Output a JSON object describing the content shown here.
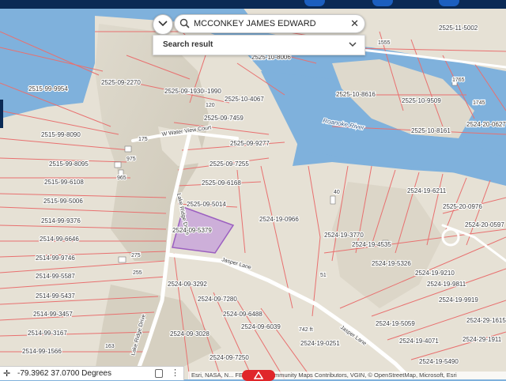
{
  "search": {
    "value": "MCCONKEY JAMES EDWARD",
    "result_label": "Search result"
  },
  "coordinates": {
    "text": "-79.3962 37.0700 Degrees"
  },
  "attribution": {
    "text": "Esri, NASA, N...   FEMA, Esri Community Maps Contributors, VGIN, © OpenStreetMap, Microsoft, Esri"
  },
  "colors": {
    "water": "#7fb1dc",
    "land": "#e8e4da",
    "hillshade": "#c9c3b2",
    "parcel_line": "#e8706f",
    "parcel_label": "#3a3a3a",
    "selected_fill": "#c7a2d9",
    "selected_stroke": "#9b5fc0",
    "road": "#ffffff",
    "accent": "#0b2a55"
  },
  "map": {
    "river_label": "Roanoke River",
    "roads": [
      {
        "id": "water-view-court",
        "label": "W Water View Court"
      },
      {
        "id": "lake-ridge-drive-upper",
        "label": "Lake Ridge Drive"
      },
      {
        "id": "lake-ridge-drive-lower",
        "label": "Lake Ridge Drive"
      },
      {
        "id": "jasper-lane-upper",
        "label": "Jasper Lane"
      },
      {
        "id": "jasper-lane-lower",
        "label": "Jasper Lane"
      }
    ],
    "parcels": [
      {
        "id": "p1",
        "label": "2525-09-1990"
      },
      {
        "id": "p2",
        "label": "2525-09-2270"
      },
      {
        "id": "p3",
        "label": "2525-09-1930"
      },
      {
        "id": "p4",
        "label": "2525-09-7459"
      },
      {
        "id": "p5",
        "label": "2525-10-4067"
      },
      {
        "id": "p6",
        "label": "2525-09-9277"
      },
      {
        "id": "p7",
        "label": "2525-09-7255"
      },
      {
        "id": "p8",
        "label": "2525-09-6168"
      },
      {
        "id": "p9",
        "label": "2525-09-5014"
      },
      {
        "id": "p10",
        "label": "2524-09-5379"
      },
      {
        "id": "p11",
        "label": "2524-19-0966"
      },
      {
        "id": "p12",
        "label": "2515-99-9954"
      },
      {
        "id": "p13",
        "label": "2515-99-8090"
      },
      {
        "id": "p14",
        "label": "2515-99-8095"
      },
      {
        "id": "p15",
        "label": "2515-99-6108"
      },
      {
        "id": "p16",
        "label": "2515-99-5006"
      },
      {
        "id": "p17",
        "label": "2514-99-9376"
      },
      {
        "id": "p18",
        "label": "2514-99-6646"
      },
      {
        "id": "p19",
        "label": "2514-99-9746"
      },
      {
        "id": "p20",
        "label": "2514-99-5587"
      },
      {
        "id": "p21",
        "label": "2514-99-5437"
      },
      {
        "id": "p22",
        "label": "2514-99-3457"
      },
      {
        "id": "p23",
        "label": "2514-99-3167"
      },
      {
        "id": "p24",
        "label": "2514-99-1566"
      },
      {
        "id": "p25",
        "label": "2524-09-3292"
      },
      {
        "id": "p26",
        "label": "2524-09-7280"
      },
      {
        "id": "p27",
        "label": "2524-09-6488"
      },
      {
        "id": "p28",
        "label": "2524-09-6039"
      },
      {
        "id": "p29",
        "label": "2524-09-3028"
      },
      {
        "id": "p30",
        "label": "2524-09-7250"
      },
      {
        "id": "p31",
        "label": "2524-19-3770"
      },
      {
        "id": "p32",
        "label": "2524-19-4535"
      },
      {
        "id": "p33",
        "label": "2524-19-5326"
      },
      {
        "id": "p34",
        "label": "2524-19-6211"
      },
      {
        "id": "p35",
        "label": "2524-19-5059"
      },
      {
        "id": "p36",
        "label": "2524-19-4071"
      },
      {
        "id": "p37",
        "label": "2524-19-0251"
      },
      {
        "id": "p38",
        "label": "2524-19-5490"
      },
      {
        "id": "p39",
        "label": "2525-10-8616"
      },
      {
        "id": "p40",
        "label": "2525-10-8161"
      },
      {
        "id": "p41",
        "label": "2525-10-9509"
      },
      {
        "id": "p42",
        "label": "2525-11-5002"
      },
      {
        "id": "p43",
        "label": "2525-10-8006"
      },
      {
        "id": "p44",
        "label": "2525-20-0976"
      },
      {
        "id": "p45",
        "label": "2524-20-0597"
      },
      {
        "id": "p46",
        "label": "2524-20-0627"
      },
      {
        "id": "p47",
        "label": "2524-19-9210"
      },
      {
        "id": "p48",
        "label": "2524-19-9811"
      },
      {
        "id": "p49",
        "label": "2524-19-9919"
      },
      {
        "id": "p50",
        "label": "2524-29-1615"
      },
      {
        "id": "p51",
        "label": "2524-29-1911"
      }
    ],
    "house_numbers": [
      {
        "id": "h1",
        "label": "120"
      },
      {
        "id": "h2",
        "label": "175"
      },
      {
        "id": "h3",
        "label": "975"
      },
      {
        "id": "h4",
        "label": "965"
      },
      {
        "id": "h5",
        "label": "275"
      },
      {
        "id": "h6",
        "label": "255"
      },
      {
        "id": "h7",
        "label": "163"
      },
      {
        "id": "h8",
        "label": "40"
      },
      {
        "id": "h9",
        "label": "51"
      },
      {
        "id": "h10",
        "label": "742 ft"
      },
      {
        "id": "h11",
        "label": "1555"
      },
      {
        "id": "h12",
        "label": "1765"
      },
      {
        "id": "h13",
        "label": "1745"
      }
    ]
  }
}
